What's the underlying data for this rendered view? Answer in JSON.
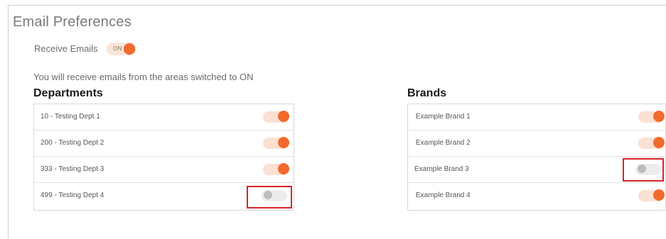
{
  "title": "Email Preferences",
  "receive_emails": {
    "label": "Receive Emails",
    "toggle_text": "ON",
    "state": "on"
  },
  "info_text": "You will receive emails from the areas switched to ON",
  "departments": {
    "heading": "Departments",
    "items": [
      {
        "label": "10 - Testing Dept 1",
        "state": "on"
      },
      {
        "label": "200 - Testing Dept 2",
        "state": "on"
      },
      {
        "label": "333 - Testing Dept 3",
        "state": "on"
      },
      {
        "label": "499 - Testing Dept 4",
        "state": "off"
      }
    ]
  },
  "brands": {
    "heading": "Brands",
    "items": [
      {
        "label": "Example Brand 1",
        "state": "on"
      },
      {
        "label": "Example Brand 2",
        "state": "on"
      },
      {
        "label": "Example Brand 3",
        "state": "off"
      },
      {
        "label": "Example Brand 4",
        "state": "on"
      }
    ]
  },
  "colors": {
    "accent": "#f26a2c",
    "highlight": "#d8232a"
  }
}
